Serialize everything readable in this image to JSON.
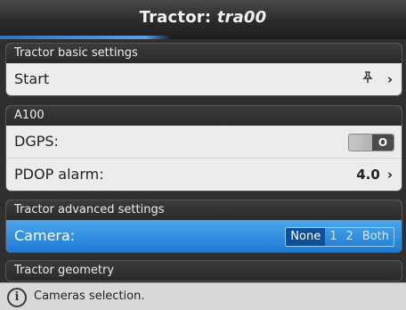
{
  "title": {
    "prefix": "Tractor: ",
    "name": "tra00"
  },
  "title_progress": 0.42,
  "sections": {
    "basic": {
      "header": "Tractor basic settings",
      "start_label": "Start",
      "pin_icon": "pin-icon",
      "chevron": "›"
    },
    "a100": {
      "header": "A100",
      "dgps_label": "DGPS:",
      "dgps_toggle_text": "O",
      "pdop_label": "PDOP alarm:",
      "pdop_value": "4.0",
      "chevron": "›"
    },
    "advanced": {
      "header": "Tractor advanced settings",
      "camera_label": "Camera:",
      "camera_options": [
        "None",
        "1",
        "2",
        "Both"
      ],
      "camera_selected": "None"
    },
    "geometry": {
      "header": "Tractor geometry"
    }
  },
  "status": {
    "icon": "info-icon",
    "glyph": "i",
    "text": "Cameras selection."
  },
  "colors": {
    "selected_row": "#2a8ae0",
    "accent": "#0d4f99"
  }
}
